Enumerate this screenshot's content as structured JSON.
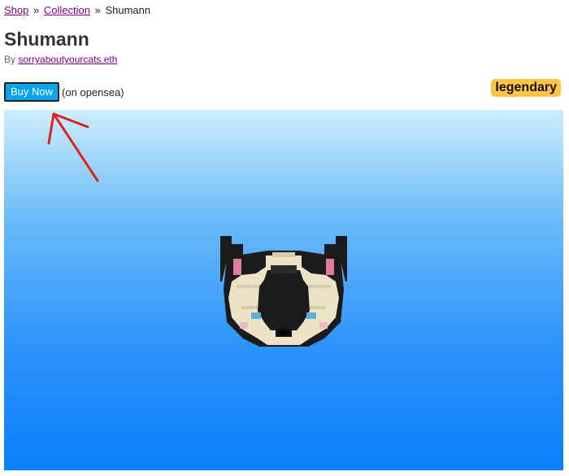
{
  "breadcrumb": {
    "items": [
      "Shop",
      "Collection"
    ],
    "current": "Shumann",
    "separator": "»"
  },
  "title": "Shumann",
  "byline": {
    "prefix": "By",
    "author": "sorryaboutyourcats.eth"
  },
  "buy": {
    "label": "Buy Now",
    "note": "(on opensea)",
    "color": "#0aa3ee"
  },
  "rarity": {
    "label": "legendary",
    "color": "#ffc445"
  },
  "viewer": {
    "subject": "voxel cat head",
    "colors": {
      "sky_top": "#cdeefe",
      "sky_bottom": "#0a7ffb",
      "fur_dark": "#1b1b1b",
      "fur_cream": "#ece3c6",
      "ear_inner": "#e07aa0",
      "eye": "#5bb0dd"
    }
  },
  "annotation": {
    "type": "red-arrow",
    "points_to": "buy-now-button",
    "color": "#e0211f"
  }
}
